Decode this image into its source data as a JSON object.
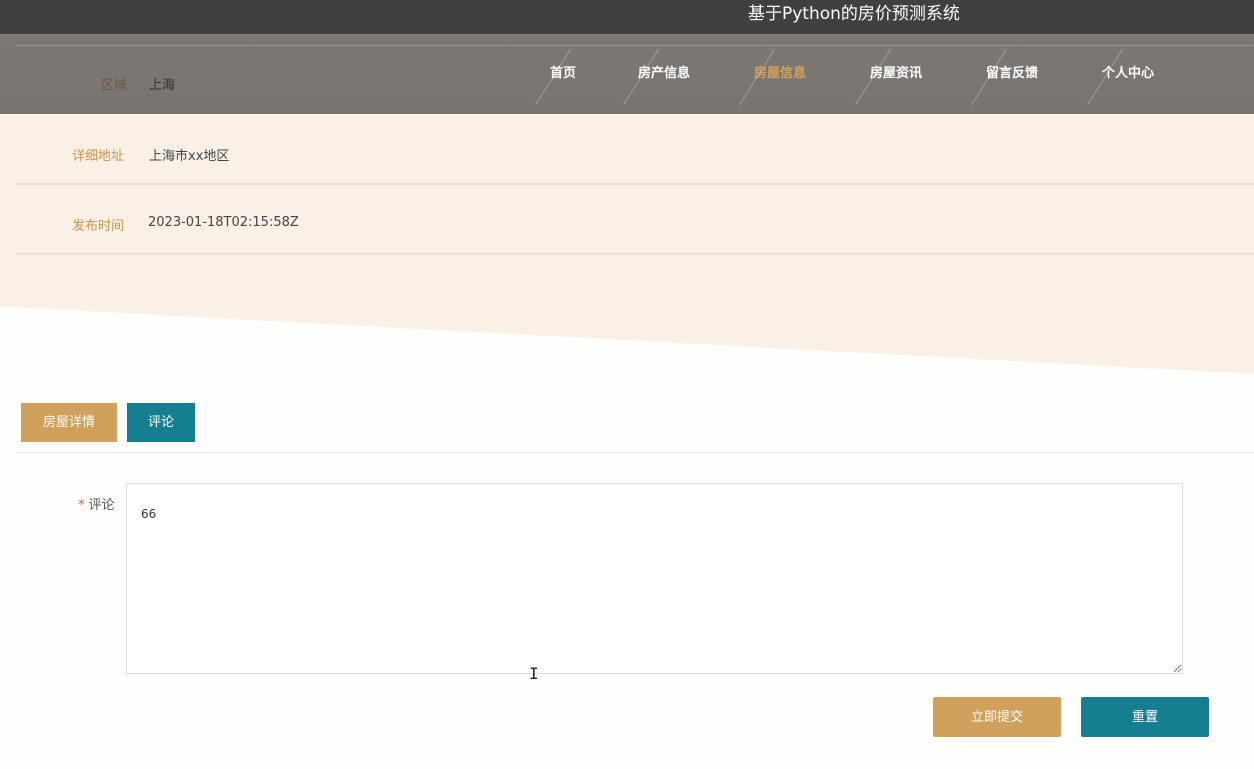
{
  "header": {
    "site_title": "基于Python的房价预测系统"
  },
  "nav": {
    "items": [
      {
        "label": "首页"
      },
      {
        "label": "房产信息"
      },
      {
        "label": "房屋信息",
        "active": true
      },
      {
        "label": "房屋资讯"
      },
      {
        "label": "留言反馈"
      },
      {
        "label": "个人中心"
      }
    ],
    "active_color": "#d1a35a"
  },
  "detail": {
    "region": {
      "label": "区域",
      "value": "上海"
    },
    "address": {
      "label": "详细地址",
      "value": "上海市xx地区"
    },
    "publish_time": {
      "label": "发布时间",
      "value": "2023-01-18T02:15:58Z"
    }
  },
  "tabs": [
    {
      "label": "房屋详情"
    },
    {
      "label": "评论",
      "active": true
    }
  ],
  "comment_form": {
    "required_mark": "*",
    "label": "评论",
    "value": "66",
    "submit_label": "立即提交",
    "reset_label": "重置"
  },
  "colors": {
    "accent_gold": "#cfa15c",
    "accent_teal": "#157f91",
    "beige_bg": "#faf0e6",
    "title_bar": "#404040"
  }
}
